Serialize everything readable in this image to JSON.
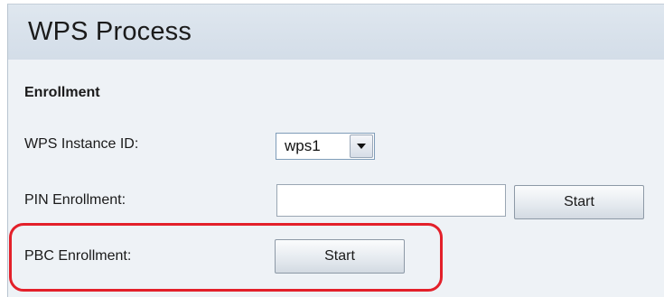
{
  "window": {
    "title": "WPS Process"
  },
  "enrollment": {
    "section_title": "Enrollment",
    "instance_id": {
      "label": "WPS Instance ID:",
      "selected": "wps1"
    },
    "pin": {
      "label": "PIN Enrollment:",
      "value": "",
      "button_label": "Start"
    },
    "pbc": {
      "label": "PBC Enrollment:",
      "button_label": "Start"
    }
  },
  "colors": {
    "highlight": "#e3202a",
    "title_bar": "#d9e2eb",
    "content_bg": "#eef2f6"
  }
}
